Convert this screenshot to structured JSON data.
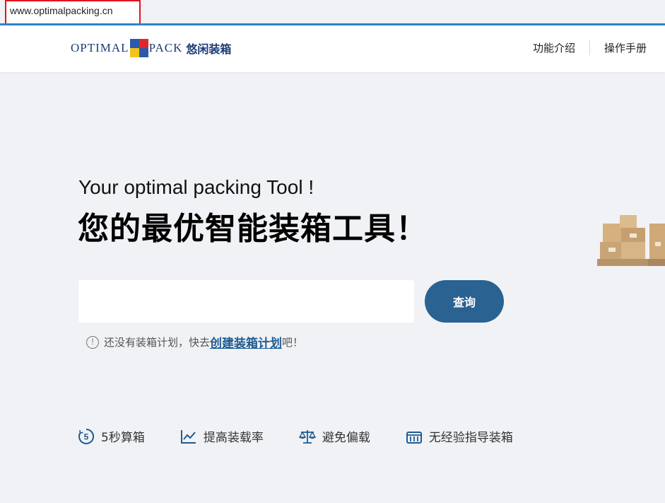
{
  "url": "www.optimalpacking.cn",
  "brand": {
    "word_left": "OPTIMAL",
    "word_right": "PACK",
    "chinese_name": "悠闲装箱",
    "colors": {
      "primary": "#2a6291",
      "accent_line": "#2b85c9",
      "navy": "#1d3b78",
      "red": "#e0262b",
      "yellow": "#f4c21b"
    }
  },
  "nav": {
    "items": [
      {
        "label": "功能介绍"
      },
      {
        "label": "操作手册"
      }
    ]
  },
  "hero": {
    "title_en": "Your optimal packing Tool !",
    "title_cn": "您的最优智能装箱工具！"
  },
  "search": {
    "placeholder": "",
    "value": "",
    "button_label": "查询"
  },
  "hint": {
    "icon": "!",
    "prefix": "还没有装箱计划，快去",
    "link": "创建装箱计划",
    "suffix": "吧！"
  },
  "features": [
    {
      "icon": "five-seconds-icon",
      "label": "5秒算箱"
    },
    {
      "icon": "trend-chart-icon",
      "label": "提高装载率"
    },
    {
      "icon": "scale-balance-icon",
      "label": "避免偏载"
    },
    {
      "icon": "container-icon",
      "label": "无经验指导装箱"
    }
  ]
}
